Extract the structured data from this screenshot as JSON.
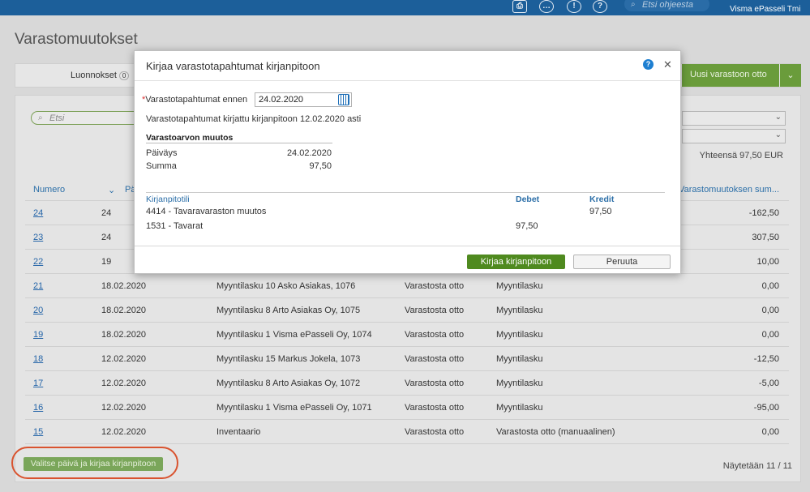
{
  "topbar": {
    "help_search_placeholder": "Etsi ohjeesta",
    "company": "Visma ePasseli Tmi"
  },
  "page": {
    "title": "Varastomuutokset",
    "drafts_label": "Luonnokset",
    "drafts_count": "0",
    "new_withdrawal_button": "Uusi varastoon otto",
    "search_placeholder": "Etsi",
    "total": "Yhteensä 97,50 EUR"
  },
  "table": {
    "columns": [
      "Numero",
      "Pä",
      "Varastomuutoksen sum..."
    ],
    "rows": [
      {
        "num": "24",
        "date": "24",
        "desc": "",
        "type": "",
        "src": "",
        "amt": "-162,50"
      },
      {
        "num": "23",
        "date": "24",
        "desc": "",
        "type": "",
        "src": "",
        "amt": "307,50"
      },
      {
        "num": "22",
        "date": "19",
        "desc": "",
        "type": "",
        "src": "",
        "amt": "10,00"
      },
      {
        "num": "21",
        "date": "18.02.2020",
        "desc": "Myyntilasku 10 Asko Asiakas, 1076",
        "type": "Varastosta otto",
        "src": "Myyntilasku",
        "amt": "0,00"
      },
      {
        "num": "20",
        "date": "18.02.2020",
        "desc": "Myyntilasku 8 Arto Asiakas Oy, 1075",
        "type": "Varastosta otto",
        "src": "Myyntilasku",
        "amt": "0,00"
      },
      {
        "num": "19",
        "date": "18.02.2020",
        "desc": "Myyntilasku 1 Visma ePasseli Oy, 1074",
        "type": "Varastosta otto",
        "src": "Myyntilasku",
        "amt": "0,00"
      },
      {
        "num": "18",
        "date": "12.02.2020",
        "desc": "Myyntilasku 15 Markus Jokela, 1073",
        "type": "Varastosta otto",
        "src": "Myyntilasku",
        "amt": "-12,50"
      },
      {
        "num": "17",
        "date": "12.02.2020",
        "desc": "Myyntilasku 8 Arto Asiakas Oy, 1072",
        "type": "Varastosta otto",
        "src": "Myyntilasku",
        "amt": "-5,00"
      },
      {
        "num": "16",
        "date": "12.02.2020",
        "desc": "Myyntilasku 1 Visma ePasseli Oy, 1071",
        "type": "Varastosta otto",
        "src": "Myyntilasku",
        "amt": "-95,00"
      },
      {
        "num": "15",
        "date": "12.02.2020",
        "desc": "Inventaario",
        "type": "Varastosta otto",
        "src": "Varastosta otto (manuaalinen)",
        "amt": "0,00"
      }
    ]
  },
  "footer": {
    "post_button": "Valitse päivä ja kirjaa kirjanpitoon",
    "pager": "Näytetään 11 / 11"
  },
  "dialog": {
    "title": "Kirjaa varastotapahtumat kirjanpitoon",
    "date_label": "Varastotapahtumat ennen",
    "date_value": "24.02.2020",
    "info": "Varastotapahtumat kirjattu kirjanpitoon 12.02.2020 asti",
    "section_title": "Varastoarvon muutos",
    "date_key": "Päiväys",
    "date_val": "24.02.2020",
    "sum_key": "Summa",
    "sum_val": "97,50",
    "col_account": "Kirjanpitotili",
    "col_debit": "Debet",
    "col_credit": "Kredit",
    "entries": [
      {
        "account": "4414 - Tavaravaraston muutos",
        "debit": "",
        "credit": "97,50"
      },
      {
        "account": "1531 - Tavarat",
        "debit": "97,50",
        "credit": ""
      }
    ],
    "confirm_button": "Kirjaa kirjanpitoon",
    "cancel_button": "Peruuta"
  },
  "colors": {
    "topbar": "#1c5f9a",
    "primary_green": "#4f8a1f",
    "link_blue": "#2565a8",
    "highlight_red": "#d9532f"
  }
}
